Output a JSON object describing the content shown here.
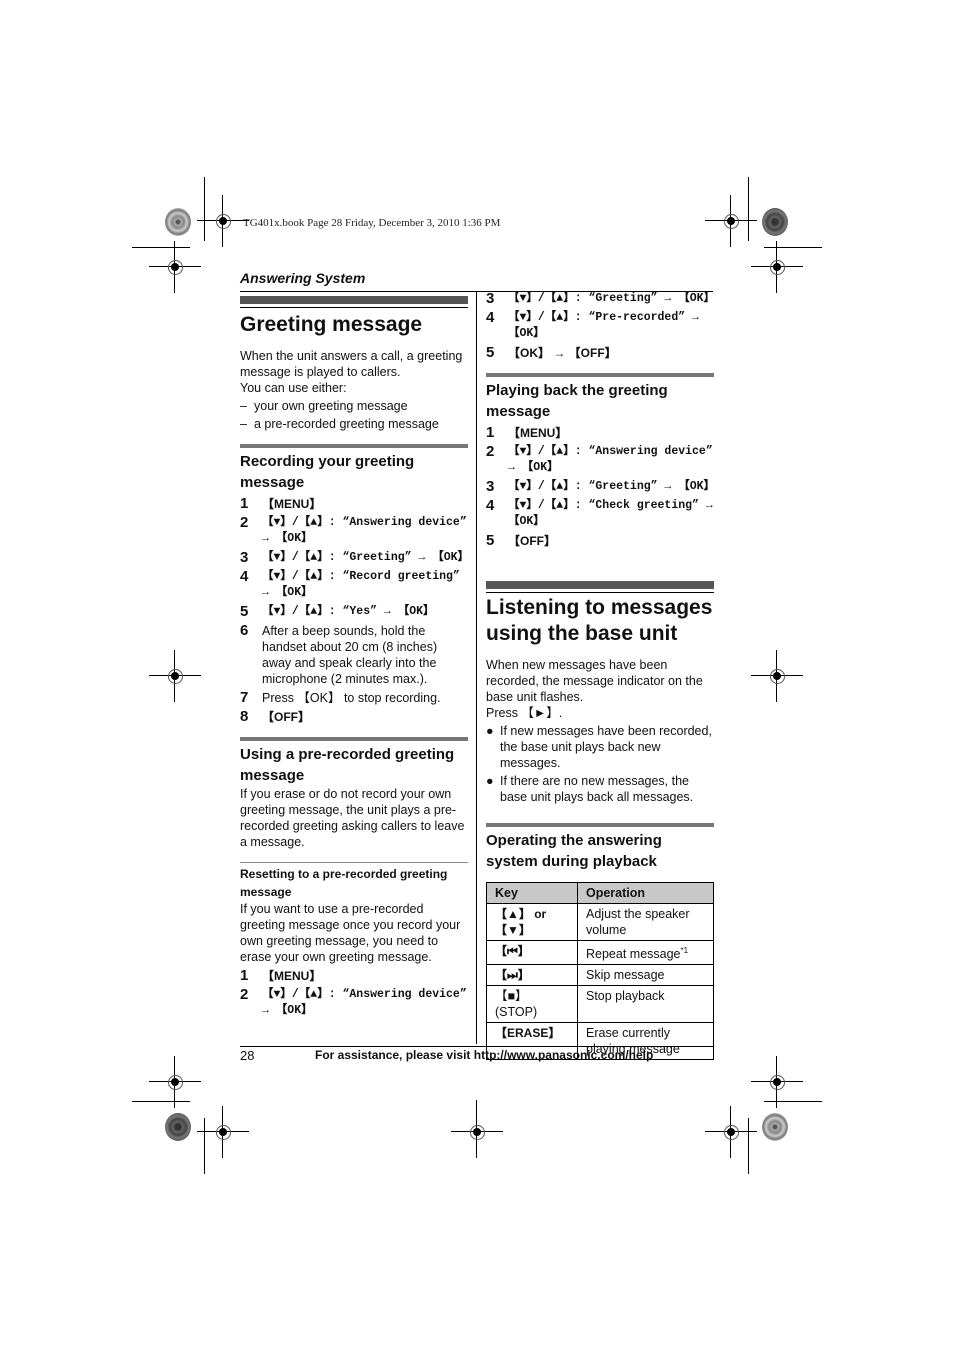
{
  "print_stamp": "TG401x.book  Page 28  Friday, December 3, 2010  1:36 PM",
  "section_title": "Answering System",
  "greeting": {
    "title": "Greeting message",
    "intro": [
      "When the unit answers a call, a greeting message is played to callers.",
      "You can use either:"
    ],
    "options": [
      "your own greeting message",
      "a pre-recorded greeting message"
    ],
    "recording": {
      "title": "Recording your greeting message",
      "steps": [
        {
          "n": "1",
          "text": "【MENU】"
        },
        {
          "n": "2",
          "text": "【▼】/【▲】: “Answering device” → 【OK】"
        },
        {
          "n": "3",
          "text": "【▼】/【▲】: “Greeting” → 【OK】"
        },
        {
          "n": "4",
          "text": "【▼】/【▲】: “Record greeting” → 【OK】"
        },
        {
          "n": "5",
          "text": "【▼】/【▲】: “Yes” → 【OK】"
        },
        {
          "n": "6",
          "text": "After a beep sounds, hold the handset about 20 cm (8 inches) away and speak clearly into the microphone (2 minutes max.)."
        },
        {
          "n": "7",
          "text": "Press 【OK】 to stop recording."
        },
        {
          "n": "8",
          "text": "【OFF】"
        }
      ]
    },
    "prerecorded": {
      "title": "Using a pre-recorded greeting message",
      "body": "If you erase or do not record your own greeting message, the unit plays a pre-recorded greeting asking callers to leave a message."
    },
    "resetting": {
      "title": "Resetting to a pre-recorded greeting message",
      "body": "If you want to use a pre-recorded greeting message once you record your own greeting message, you need to erase your own greeting message.",
      "steps": [
        {
          "n": "1",
          "text": "【MENU】"
        },
        {
          "n": "2",
          "text": "【▼】/【▲】: “Answering device” → 【OK】"
        },
        {
          "n": "3",
          "text": "【▼】/【▲】: “Greeting” → 【OK】"
        },
        {
          "n": "4",
          "text": "【▼】/【▲】: “Pre-recorded” → 【OK】"
        },
        {
          "n": "5",
          "text": "【OK】 → 【OFF】"
        }
      ]
    },
    "playback": {
      "title": "Playing back the greeting message",
      "steps": [
        {
          "n": "1",
          "text": "【MENU】"
        },
        {
          "n": "2",
          "text": "【▼】/【▲】: “Answering device” → 【OK】"
        },
        {
          "n": "3",
          "text": "【▼】/【▲】: “Greeting” → 【OK】"
        },
        {
          "n": "4",
          "text": "【▼】/【▲】: “Check greeting” → 【OK】"
        },
        {
          "n": "5",
          "text": "【OFF】"
        }
      ]
    }
  },
  "listening": {
    "title": "Listening to messages using the base unit",
    "intro": "When new messages have been recorded, the message indicator on the base unit flashes.",
    "press": "Press 【►】.",
    "bullets": [
      "If new messages have been recorded, the base unit plays back new messages.",
      "If there are no new messages, the base unit plays back all messages."
    ],
    "operating": {
      "title": "Operating the answering system during playback",
      "columns": [
        "Key",
        "Operation"
      ],
      "rows": [
        {
          "key": "【▲】 or 【▼】",
          "op": "Adjust the speaker volume",
          "note": ""
        },
        {
          "key": "【⏮】",
          "op": "Repeat message",
          "note": "*1"
        },
        {
          "key": "【⏭】",
          "op": "Skip message",
          "note": ""
        },
        {
          "key": "【■】 (STOP)",
          "op": "Stop playback",
          "note": ""
        },
        {
          "key": "【ERASE】",
          "op": "Erase currently playing message",
          "note": ""
        }
      ]
    }
  },
  "footer": {
    "page_number": "28",
    "assistance": "For assistance, please visit http://www.panasonic.com/help"
  }
}
